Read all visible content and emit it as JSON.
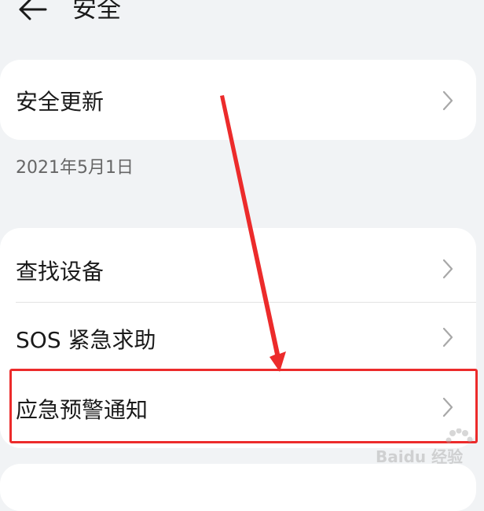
{
  "header": {
    "title": "安全",
    "back_icon": "back-arrow-icon"
  },
  "security_update": {
    "label": "安全更新",
    "date": "2021年5月1日"
  },
  "settings_items": [
    {
      "label": "查找设备"
    },
    {
      "label": "SOS 紧急求助"
    },
    {
      "label": "应急预警通知"
    }
  ],
  "annotation": {
    "highlight_color": "#ec2b2b"
  },
  "watermark": {
    "text": "Baidu 经验"
  }
}
